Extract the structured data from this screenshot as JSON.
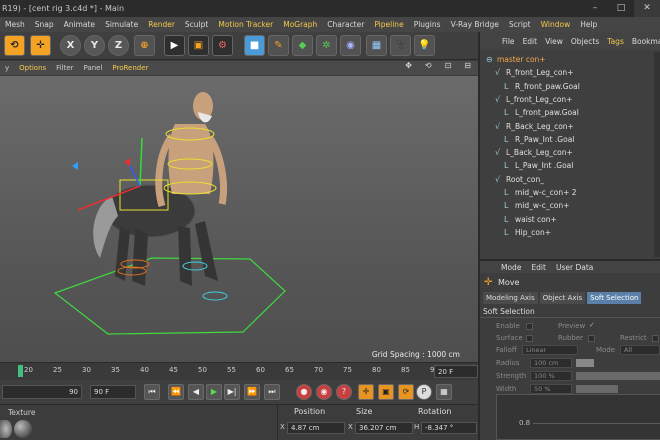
{
  "window": {
    "title": "R19) - [cent rig 3.c4d *] - Main",
    "controls": [
      "–",
      "□",
      "✕"
    ]
  },
  "menubar": {
    "items": [
      {
        "label": "Mesh",
        "hl": false
      },
      {
        "label": "Snap",
        "hl": false
      },
      {
        "label": "Animate",
        "hl": false
      },
      {
        "label": "Simulate",
        "hl": false
      },
      {
        "label": "Render",
        "hl": true
      },
      {
        "label": "Sculpt",
        "hl": false
      },
      {
        "label": "Motion Tracker",
        "hl": true
      },
      {
        "label": "MoGraph",
        "hl": true
      },
      {
        "label": "Character",
        "hl": false
      },
      {
        "label": "Pipeline",
        "hl": true
      },
      {
        "label": "Plugins",
        "hl": false
      },
      {
        "label": "V-Ray Bridge",
        "hl": false
      },
      {
        "label": "Script",
        "hl": false
      },
      {
        "label": "Window",
        "hl": true
      },
      {
        "label": "Help",
        "hl": false
      }
    ]
  },
  "toolbar": {
    "x_label": "X",
    "y_label": "Y",
    "z_label": "Z"
  },
  "viewport": {
    "menu": [
      {
        "label": "y",
        "hl": false
      },
      {
        "label": "Options",
        "hl": true
      },
      {
        "label": "Filter",
        "hl": false
      },
      {
        "label": "Panel",
        "hl": false
      },
      {
        "label": "ProRender",
        "hl": true
      }
    ],
    "icons": [
      "✥",
      "⟲",
      "⊡",
      "⊟"
    ],
    "grid_spacing": "Grid Spacing : 1000 cm"
  },
  "timeline": {
    "ticks": [
      "20",
      "25",
      "30",
      "35",
      "40",
      "45",
      "50",
      "55",
      "60",
      "65",
      "70",
      "75",
      "80",
      "85",
      "90"
    ],
    "frame_field": "20 F"
  },
  "playback": {
    "start_field": "90",
    "end_field": "90 F"
  },
  "materials": {
    "label": "Texture"
  },
  "coords": {
    "headers": {
      "position": "Position",
      "size": "Size",
      "rotation": "Rotation"
    },
    "row": {
      "axis_x": "X",
      "pos_x": "4.87 cm",
      "size_label": "X",
      "size_x": "36.207 cm",
      "rot_label": "H",
      "rot_h": "-8.347 °"
    }
  },
  "objects": {
    "menu": [
      {
        "label": "File",
        "hl": false
      },
      {
        "label": "Edit",
        "hl": false
      },
      {
        "label": "View",
        "hl": false
      },
      {
        "label": "Objects",
        "hl": false
      },
      {
        "label": "Tags",
        "hl": true
      },
      {
        "label": "Bookmar",
        "hl": false
      }
    ],
    "items": [
      {
        "label": "master con+",
        "indent": 0,
        "color": "#f2a84c"
      },
      {
        "label": "R_front_Leg_con+",
        "indent": 1,
        "color": "#e0e0e0"
      },
      {
        "label": "R_front_paw.Goal",
        "indent": 2,
        "color": "#e0e0e0"
      },
      {
        "label": "L_front_Leg_con+",
        "indent": 1,
        "color": "#e0e0e0"
      },
      {
        "label": "L_front_paw.Goal",
        "indent": 2,
        "color": "#e0e0e0"
      },
      {
        "label": "R_Back_Leg_con+",
        "indent": 1,
        "color": "#e0e0e0"
      },
      {
        "label": "R_Paw_Int .Goal",
        "indent": 2,
        "color": "#e0e0e0"
      },
      {
        "label": "L_Back_Leg_con+",
        "indent": 1,
        "color": "#e0e0e0"
      },
      {
        "label": "L_Paw_Int .Goal",
        "indent": 2,
        "color": "#e0e0e0"
      },
      {
        "label": "Root_con_",
        "indent": 1,
        "color": "#e0e0e0"
      },
      {
        "label": "mid_w-c_con+ 2",
        "indent": 2,
        "color": "#e0e0e0"
      },
      {
        "label": "mid_w-c_con+",
        "indent": 2,
        "color": "#e0e0e0"
      },
      {
        "label": "waist con+",
        "indent": 2,
        "color": "#e0e0e0"
      },
      {
        "label": "Hip_con+",
        "indent": 2,
        "color": "#e0e0e0"
      }
    ]
  },
  "attributes": {
    "menu": [
      "Mode",
      "Edit",
      "User Data"
    ],
    "tool": "Move",
    "tabs": [
      {
        "label": "Modeling Axis",
        "active": false
      },
      {
        "label": "Object Axis",
        "active": false
      },
      {
        "label": "Soft Selection",
        "active": true
      }
    ],
    "section": "Soft Selection",
    "enable": "Enable",
    "preview": "Preview",
    "surface": "Surface",
    "rubber": "Rubber",
    "restrict": "Restrict",
    "falloff": "Falloff",
    "falloff_value": "Linear",
    "mode": "Mode",
    "mode_value": "All",
    "radius": "Radius",
    "radius_value": "100 cm",
    "strength": "Strength",
    "strength_value": "100 %",
    "width": "Width",
    "width_value": "50 %",
    "graph_tick": "0.8"
  }
}
